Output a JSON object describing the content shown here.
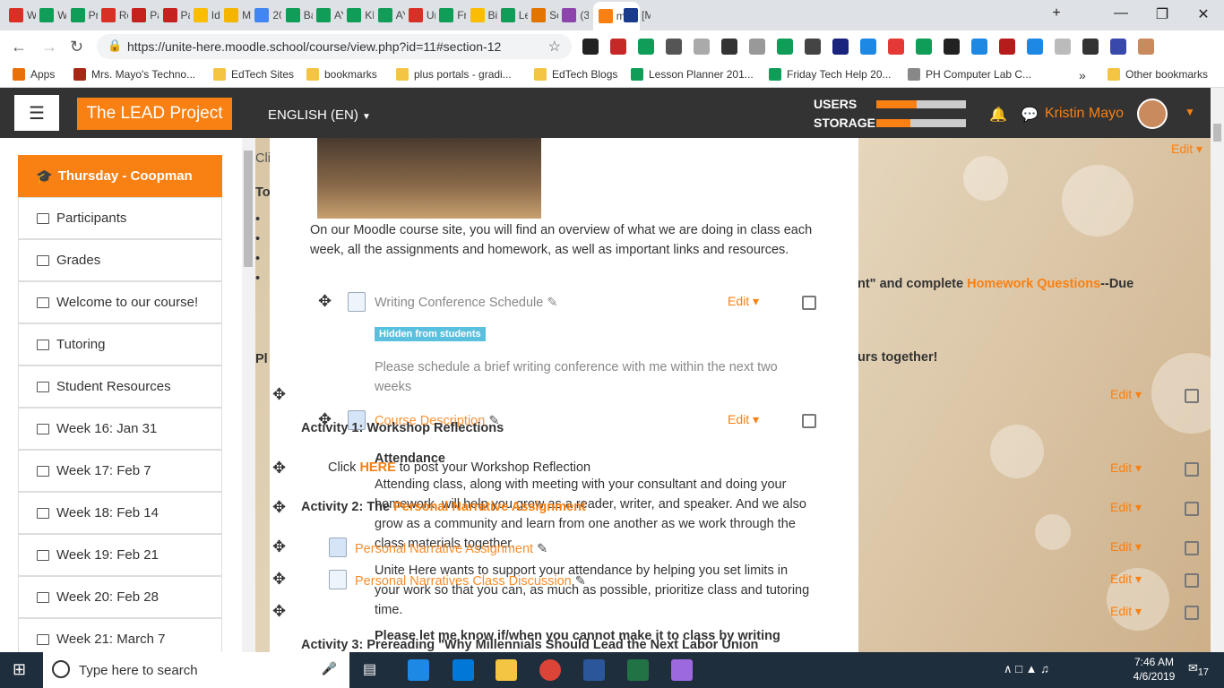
{
  "browser": {
    "tabs": [
      {
        "label": "Wi",
        "color": "#d93025"
      },
      {
        "label": "Wi",
        "color": "#0f9d58"
      },
      {
        "label": "Pri",
        "color": "#0f9d58"
      },
      {
        "label": "Re",
        "color": "#d93025"
      },
      {
        "label": "Pa",
        "color": "#c5221f"
      },
      {
        "label": "Pa",
        "color": "#c5221f"
      },
      {
        "label": "Idi",
        "color": "#fbbc04"
      },
      {
        "label": "Ma",
        "color": "#f4b400"
      },
      {
        "label": "20",
        "color": "#4285f4"
      },
      {
        "label": "Ba",
        "color": "#0f9d58"
      },
      {
        "label": "AY",
        "color": "#0f9d58"
      },
      {
        "label": "KN",
        "color": "#0f9d58"
      },
      {
        "label": "AY",
        "color": "#0f9d58"
      },
      {
        "label": "Un",
        "color": "#d93025"
      },
      {
        "label": "Fri",
        "color": "#0f9d58"
      },
      {
        "label": "Bic",
        "color": "#fbbc04"
      },
      {
        "label": "Le",
        "color": "#0f9d58"
      },
      {
        "label": "Sc",
        "color": "#e37400"
      },
      {
        "label": "(30",
        "color": "#8e44ad"
      },
      {
        "label": "m",
        "color": "#f98012"
      },
      {
        "label": "[M",
        "color": "#1a3a8a"
      }
    ],
    "new_tab": "+",
    "url": "https://unite-here.moodle.school/course/view.php?id=11#section-12",
    "bookmarks": [
      {
        "label": "Apps",
        "color": "#e8710a"
      },
      {
        "label": "Mrs. Mayo's Techno...",
        "color": "#a52714"
      },
      {
        "label": "EdTech Sites",
        "color": "#f4c542"
      },
      {
        "label": "bookmarks",
        "color": "#f4c542"
      },
      {
        "label": "plus portals - gradi...",
        "color": "#f4c542"
      },
      {
        "label": "EdTech Blogs",
        "color": "#f4c542"
      },
      {
        "label": "Lesson Planner 201...",
        "color": "#0f9d58"
      },
      {
        "label": "Friday Tech Help 20...",
        "color": "#0f9d58"
      },
      {
        "label": "PH Computer Lab C...",
        "color": "#888888"
      }
    ],
    "more_bookmarks": "»",
    "other_bookmarks": "Other bookmarks"
  },
  "header": {
    "brand": "The LEAD Project",
    "language": "ENGLISH (EN)",
    "users_label": "USERS",
    "users_fraction": 0.45,
    "storage_label": "STORAGE",
    "storage_fraction": 0.38,
    "user_name": "Kristin Mayo"
  },
  "sidebar": {
    "current": "Thursday - Coopman",
    "items": [
      "Participants",
      "Grades",
      "Welcome to our course!",
      "Tutoring",
      "Student Resources",
      "Week 16: Jan 31",
      "Week 17: Feb 7",
      "Week 18: Feb 14",
      "Week 19: Feb 21",
      "Week 20: Feb 28",
      "Week 21: March 7"
    ]
  },
  "content": {
    "intro": "On our Moodle course site, you will find an overview of what we are doing in class each week, all the assignments and homework, as well as important links and resources.",
    "writing_conf": "Writing Conference Schedule",
    "hidden_badge": "Hidden from students",
    "writing_conf_desc": "Please schedule a brief writing conference with me within the next two weeks",
    "course_desc": "Course Description",
    "activity1": "Activity 1: Workshop Reflections",
    "attendance_heading": "Attendance",
    "click_here_pre": "Click ",
    "click_here_link": "HERE",
    "click_here_post": " to post your Workshop Reflection",
    "attendance_p1": "Attending class, along with meeting with your consultant and doing your homework, will help you grow as a reader, writer, and speaker.  And we also grow as a community and learn from one another as we work through the class materials together.",
    "activity2_pre": "Activity 2: The ",
    "activity2_link": "Personal Narrative Assignment",
    "pna": "Personal Narrative Assignment",
    "attendance_p2": "Unite Here wants to support your attendance by helping you set limits in your work so that you can, as much as possible, prioritize class and tutoring time.",
    "pncd": "Personal Narratives Class Discussion",
    "attendance_p3": "Please let me know if/when you cannot make it to class by writing",
    "activity3": "Activity 3: Prereading \"Why Millennials Should Lead the Next Labor Union",
    "bg_cli": "Cli",
    "bg_to": "To",
    "bg_pl": "Pl",
    "bg_hw_pre": "nt\" and complete ",
    "bg_hw_link": "Homework Questions",
    "bg_hw_post": "--Due",
    "bg_hours": "urs together!",
    "edit": "Edit"
  },
  "taskbar": {
    "search_placeholder": "Type here to search",
    "time": "7:46 AM",
    "date": "4/6/2019",
    "notif": "17"
  }
}
